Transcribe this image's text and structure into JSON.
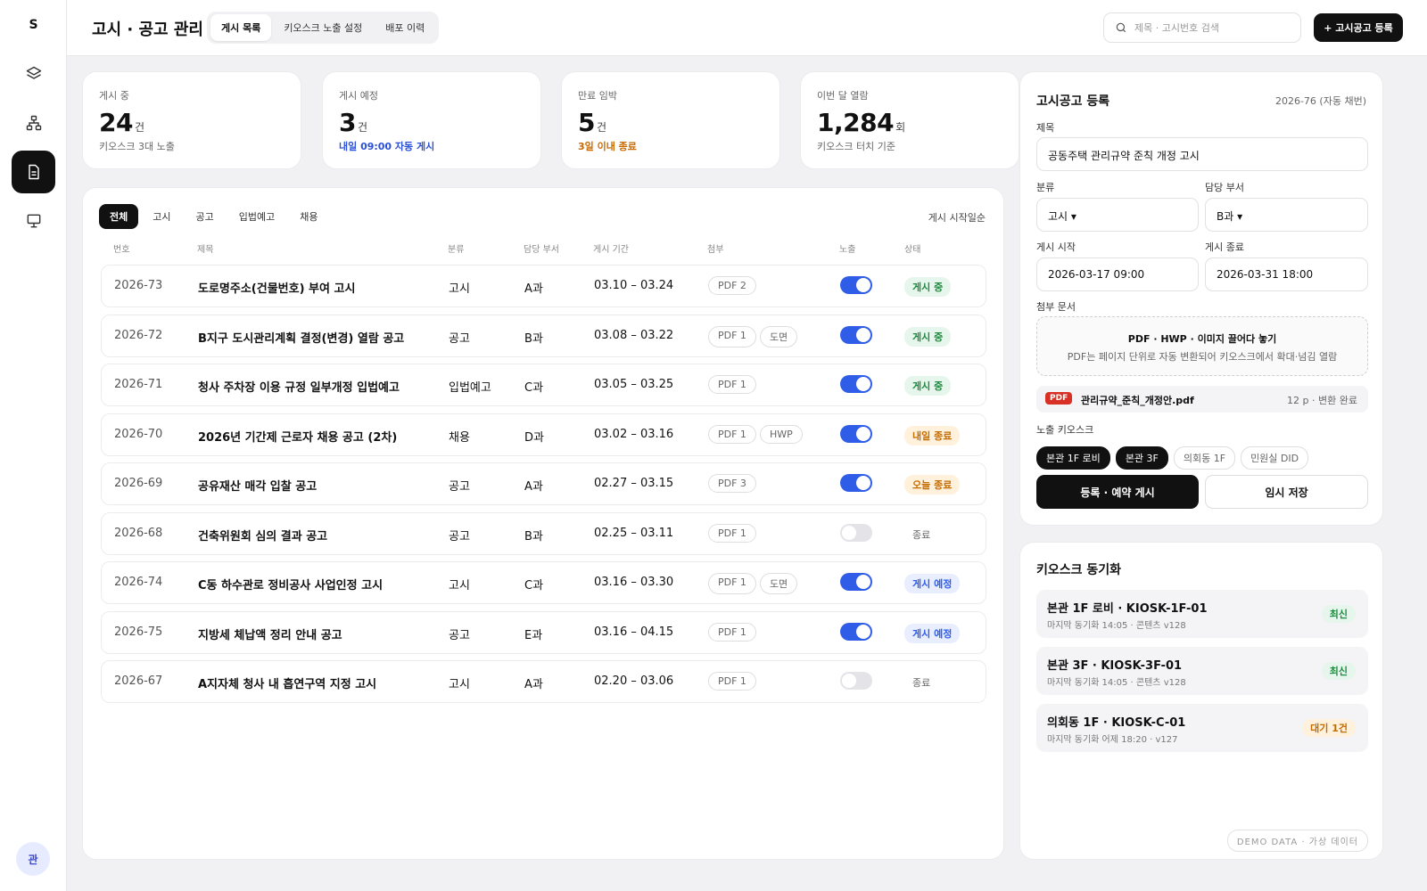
{
  "sidebar": {
    "logo": "S",
    "avatar": "관"
  },
  "header": {
    "title": "고시 · 공고 관리",
    "tabs": [
      "게시 목록",
      "키오스크 노출 설정",
      "배포 이력"
    ],
    "search_placeholder": "제목 · 고시번호 검색",
    "primary_button": "+ 고시공고 등록"
  },
  "stats": [
    {
      "label": "게시 중",
      "value": "24",
      "unit": "건",
      "sub": "키오스크 3대 노출"
    },
    {
      "label": "게시 예정",
      "value": "3",
      "unit": "건",
      "sub": "내일 09:00 자동 게시"
    },
    {
      "label": "만료 임박",
      "value": "5",
      "unit": "건",
      "sub": "3일 이내 종료"
    },
    {
      "label": "이번 달 열람",
      "value": "1,284",
      "unit": "회",
      "sub": "키오스크 터치 기준"
    }
  ],
  "list": {
    "filters": [
      "전체",
      "고시",
      "공고",
      "입법예고",
      "채용"
    ],
    "sort_label": "게시 시작일순",
    "columns": [
      "번호",
      "제목",
      "분류",
      "담당 부서",
      "게시 기간",
      "첨부",
      "노출",
      "상태"
    ],
    "rows": [
      {
        "no": "2026-73",
        "title": "도로명주소(건물번호) 부여 고시",
        "cat": "고시",
        "dept": "A과",
        "period": "03.10 – 03.24",
        "att": [
          "PDF 2"
        ],
        "exposed": true,
        "status": "게시 중",
        "status_type": "green"
      },
      {
        "no": "2026-72",
        "title": "B지구 도시관리계획 결정(변경) 열람 공고",
        "cat": "공고",
        "dept": "B과",
        "period": "03.08 – 03.22",
        "att": [
          "PDF 1",
          "도면"
        ],
        "exposed": true,
        "status": "게시 중",
        "status_type": "green"
      },
      {
        "no": "2026-71",
        "title": "청사 주차장 이용 규정 일부개정 입법예고",
        "cat": "입법예고",
        "dept": "C과",
        "period": "03.05 – 03.25",
        "att": [
          "PDF 1"
        ],
        "exposed": true,
        "status": "게시 중",
        "status_type": "green"
      },
      {
        "no": "2026-70",
        "title": "2026년 기간제 근로자 채용 공고 (2차)",
        "cat": "채용",
        "dept": "D과",
        "period": "03.02 – 03.16",
        "att": [
          "PDF 1",
          "HWP"
        ],
        "exposed": true,
        "status": "내일 종료",
        "status_type": "orange"
      },
      {
        "no": "2026-69",
        "title": "공유재산 매각 입찰 공고",
        "cat": "공고",
        "dept": "A과",
        "period": "02.27 – 03.15",
        "att": [
          "PDF 3"
        ],
        "exposed": true,
        "status": "오늘 종료",
        "status_type": "orange"
      },
      {
        "no": "2026-68",
        "title": "건축위원회 심의 결과 공고",
        "cat": "공고",
        "dept": "B과",
        "period": "02.25 – 03.11",
        "att": [
          "PDF 1"
        ],
        "exposed": false,
        "status": "종료",
        "status_type": "gray"
      },
      {
        "no": "2026-74",
        "title": "C동 하수관로 정비공사 사업인정 고시",
        "cat": "고시",
        "dept": "C과",
        "period": "03.16 – 03.30",
        "att": [
          "PDF 1",
          "도면"
        ],
        "exposed": true,
        "status": "게시 예정",
        "status_type": "blue"
      },
      {
        "no": "2026-75",
        "title": "지방세 체납액 정리 안내 공고",
        "cat": "공고",
        "dept": "E과",
        "period": "03.16 – 04.15",
        "att": [
          "PDF 1"
        ],
        "exposed": true,
        "status": "게시 예정",
        "status_type": "blue"
      },
      {
        "no": "2026-67",
        "title": "A지자체 청사 내 흡연구역 지정 고시",
        "cat": "고시",
        "dept": "A과",
        "period": "02.20 – 03.06",
        "att": [
          "PDF 1"
        ],
        "exposed": false,
        "status": "종료",
        "status_type": "gray"
      }
    ]
  },
  "register": {
    "title": "고시공고 등록",
    "meta": "2026-76 (자동 채번)",
    "title_label": "제목",
    "title_value": "공동주택 관리규약 준칙 개정 고시",
    "cat_label": "분류",
    "cat_value": "고시 ▾",
    "dept_label": "담당 부서",
    "dept_value": "B과 ▾",
    "start_label": "게시 시작",
    "start_value": "2026-03-17 09:00",
    "end_label": "게시 종료",
    "end_value": "2026-03-31 18:00",
    "attach_label": "첨부 문서",
    "dropzone_title": "PDF · HWP · 이미지 끌어다 놓기",
    "dropzone_sub": "PDF는 페이지 단위로 자동 변환되어 키오스크에서 확대·넘김 열람",
    "file_tag": "PDF",
    "file_name": "관리규약_준칙_개정안.pdf",
    "file_meta": "12 p · 변환 완료",
    "kiosk_label": "노출 키오스크",
    "kiosks": [
      {
        "label": "본관 1F 로비",
        "on": true
      },
      {
        "label": "본관 3F",
        "on": true
      },
      {
        "label": "의회동 1F",
        "on": false
      },
      {
        "label": "민원실 DID",
        "on": false
      }
    ],
    "submit": "등록 · 예약 게시",
    "save": "임시 저장"
  },
  "sync": {
    "title": "키오스크 동기화",
    "items": [
      {
        "name": "본관 1F 로비 · KIOSK-1F-01",
        "meta": "마지막 동기화 14:05 · 콘텐츠 v128",
        "badge": "최신",
        "type": "green"
      },
      {
        "name": "본관 3F · KIOSK-3F-01",
        "meta": "마지막 동기화 14:05 · 콘텐츠 v128",
        "badge": "최신",
        "type": "green"
      },
      {
        "name": "의회동 1F · KIOSK-C-01",
        "meta": "마지막 동기화 어제 18:20 · v127",
        "badge": "대기 1건",
        "type": "orange"
      }
    ],
    "demo": "DEMO DATA · 가상 데이터"
  }
}
